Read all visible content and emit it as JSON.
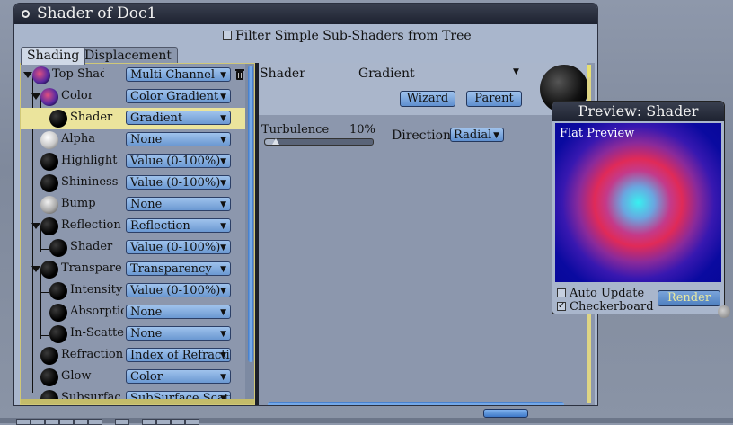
{
  "window": {
    "title": "Shader of Doc1",
    "filter_label": "Filter Simple Sub-Shaders from Tree",
    "filter_checked": false
  },
  "tabs": [
    {
      "label": "Shading",
      "active": true
    },
    {
      "label": "Displacement",
      "active": false
    }
  ],
  "tree": {
    "rows": [
      {
        "label": "Top Shade",
        "value": "Multi Channel"
      },
      {
        "label": "Color",
        "value": "Color Gradient"
      },
      {
        "label": "Shader",
        "value": "Gradient",
        "selected": true
      },
      {
        "label": "Alpha",
        "value": "None"
      },
      {
        "label": "Highlight",
        "value": "Value (0-100%)"
      },
      {
        "label": "Shininess",
        "value": "Value (0-100%)"
      },
      {
        "label": "Bump",
        "value": "None"
      },
      {
        "label": "Reflection",
        "value": "Reflection"
      },
      {
        "label": "Shader",
        "value": "Value (0-100%)"
      },
      {
        "label": "Transpare",
        "value": "Transparency"
      },
      {
        "label": "Intensity",
        "value": "Value (0-100%)"
      },
      {
        "label": "Absorptio",
        "value": "None"
      },
      {
        "label": "In-Scatter",
        "value": "None"
      },
      {
        "label": "Refraction",
        "value": "Index of Refraction"
      },
      {
        "label": "Glow",
        "value": "Color"
      },
      {
        "label": "Subsurfac",
        "value": "SubSurface Scatter"
      }
    ]
  },
  "editor": {
    "shader_label": "Shader",
    "shader_value": "Gradient",
    "wizard_label": "Wizard",
    "parent_label": "Parent",
    "turbulence_label": "Turbulence",
    "turbulence_value": "10%",
    "turbulence_fraction": 0.1,
    "direction_label": "Direction",
    "direction_value": "Radial"
  },
  "preview": {
    "title": "Preview: Shader",
    "canvas_label": "Flat Preview",
    "auto_update_label": "Auto Update",
    "auto_update_checked": false,
    "checkerboard_label": "Checkerboard",
    "checkerboard_checked": true,
    "render_label": "Render"
  },
  "icons": {
    "trash": "trash-icon",
    "chevron": "chevron-down-icon",
    "ball": "shader-ball-icon"
  },
  "colors": {
    "accent_button": "#7aa8e0",
    "selection": "#ebe49c",
    "titlebar": "#23283a"
  }
}
